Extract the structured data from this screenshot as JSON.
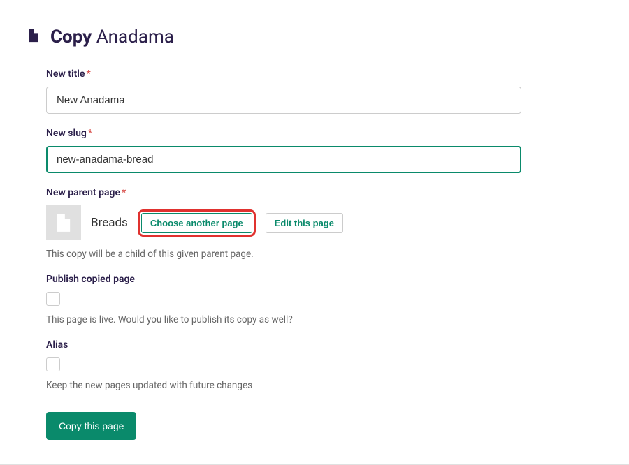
{
  "header": {
    "action": "Copy",
    "page_name": "Anadama"
  },
  "fields": {
    "new_title": {
      "label": "New title",
      "required_mark": "*",
      "value": "New Anadama"
    },
    "new_slug": {
      "label": "New slug",
      "required_mark": "*",
      "value": "new-anadama-bread"
    },
    "parent": {
      "label": "New parent page",
      "required_mark": "*",
      "name": "Breads",
      "choose_label": "Choose another page",
      "edit_label": "Edit this page",
      "help": "This copy will be a child of this given parent page."
    },
    "publish": {
      "label": "Publish copied page",
      "help": "This page is live. Would you like to publish its copy as well?"
    },
    "alias": {
      "label": "Alias",
      "help": "Keep the new pages updated with future changes"
    }
  },
  "submit": {
    "label": "Copy this page"
  }
}
